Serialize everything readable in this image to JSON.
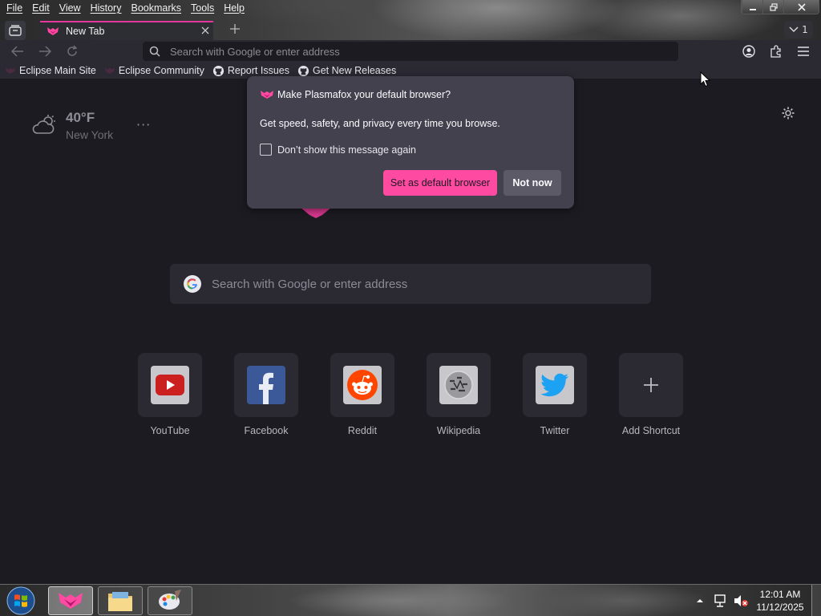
{
  "menubar": {
    "items": [
      "File",
      "Edit",
      "View",
      "History",
      "Bookmarks",
      "Tools",
      "Help"
    ]
  },
  "window_controls": {
    "minimize": "–",
    "restore": "❐",
    "close": "✕"
  },
  "tabs": [
    {
      "title": "New Tab",
      "active": true
    }
  ],
  "tab_count": "1",
  "urlbar": {
    "placeholder": "Search with Google or enter address"
  },
  "bookmarks": [
    {
      "label": "Eclipse Main Site",
      "icon": "plasmafox-icon"
    },
    {
      "label": "Eclipse Community",
      "icon": "plasmafox-icon"
    },
    {
      "label": "Report Issues",
      "icon": "github-icon"
    },
    {
      "label": "Get New Releases",
      "icon": "github-icon"
    }
  ],
  "weather": {
    "temperature": "40°F",
    "city": "New York",
    "menu": "···"
  },
  "search": {
    "placeholder": "Search with Google or enter address"
  },
  "shortcuts": [
    {
      "label": "YouTube",
      "icon": "youtube-icon",
      "color": "#cc1f1f"
    },
    {
      "label": "Facebook",
      "icon": "facebook-icon",
      "color": "#3b5998"
    },
    {
      "label": "Reddit",
      "icon": "reddit-icon",
      "color": "#ff4500"
    },
    {
      "label": "Wikipedia",
      "icon": "wikipedia-icon",
      "color": "#9a9a9a"
    },
    {
      "label": "Twitter",
      "icon": "twitter-icon",
      "color": "#1da1f2"
    },
    {
      "label": "Add Shortcut",
      "icon": "plus-icon",
      "color": "#2b2a33"
    }
  ],
  "default_browser_popup": {
    "title": "Make Plasmafox your default browser?",
    "message": "Get speed, safety, and privacy every time you browse.",
    "checkbox_label": "Don’t show this message again",
    "checkbox_checked": false,
    "primary_button": "Set as default browser",
    "secondary_button": "Not now",
    "accent_color": "#ff4aa2"
  },
  "taskbar": {
    "clock_time": "12:01 AM",
    "clock_date": "11/12/2025",
    "apps": [
      "plasmafox",
      "file-explorer",
      "paint"
    ]
  }
}
